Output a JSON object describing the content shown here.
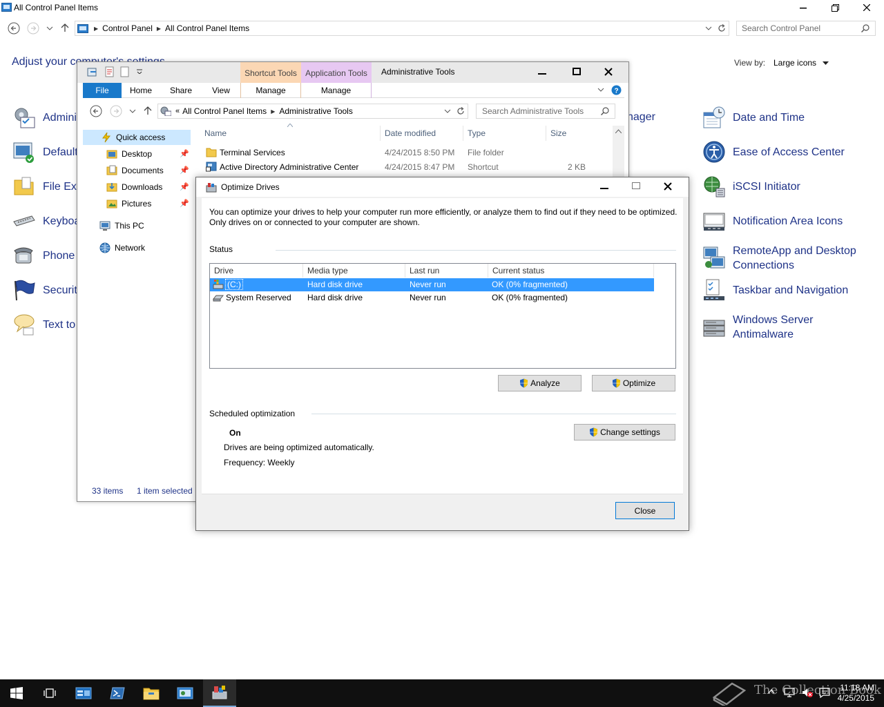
{
  "control_panel": {
    "title": "All Control Panel Items",
    "breadcrumb": [
      "Control Panel",
      "All Control Panel Items"
    ],
    "search_placeholder": "Search Control Panel",
    "heading": "Adjust your computer's settings",
    "view_by_label": "View by:",
    "view_by_value": "Large icons",
    "left_items": [
      {
        "label": "Administrative Tools",
        "icon": "admin-tools-icon"
      },
      {
        "label": "Default Programs",
        "icon": "default-programs-icon"
      },
      {
        "label": "File Explorer Options",
        "icon": "folder-options-icon"
      },
      {
        "label": "Keyboard",
        "icon": "keyboard-icon"
      },
      {
        "label": "Phone and Modem",
        "icon": "phone-icon"
      },
      {
        "label": "Security and Maintenance",
        "icon": "flag-icon"
      },
      {
        "label": "Text to Speech",
        "icon": "speech-icon"
      }
    ],
    "partial_item": "nager",
    "right_items": [
      {
        "label": "Date and Time",
        "icon": "clock-calendar-icon"
      },
      {
        "label": "Ease of Access Center",
        "icon": "ease-of-access-icon"
      },
      {
        "label": "iSCSI Initiator",
        "icon": "iscsi-icon"
      },
      {
        "label": "Notification Area Icons",
        "icon": "notification-icon"
      },
      {
        "label": "RemoteApp and Desktop Connections",
        "icon": "remoteapp-icon"
      },
      {
        "label": "Taskbar and Navigation",
        "icon": "taskbar-icon"
      },
      {
        "label": "Windows Server Antimalware",
        "icon": "antimalware-icon"
      }
    ]
  },
  "explorer": {
    "title": "Administrative Tools",
    "context_tabs": {
      "shortcut": "Shortcut Tools",
      "application": "Application Tools"
    },
    "ribbon_tabs": [
      "File",
      "Home",
      "Share",
      "View",
      "Manage",
      "Manage"
    ],
    "address": [
      "All Control Panel Items",
      "Administrative Tools"
    ],
    "search_placeholder": "Search Administrative Tools",
    "nav": {
      "quick_access": "Quick access",
      "pinned": [
        "Desktop",
        "Documents",
        "Downloads",
        "Pictures"
      ],
      "this_pc": "This PC",
      "network": "Network"
    },
    "columns": [
      "Name",
      "Date modified",
      "Type",
      "Size"
    ],
    "rows": [
      {
        "name": "Terminal Services",
        "date": "4/24/2015 8:50 PM",
        "type": "File folder",
        "size": ""
      },
      {
        "name": "Active Directory Administrative Center",
        "date": "4/24/2015 8:47 PM",
        "type": "Shortcut",
        "size": "2 KB"
      }
    ],
    "status": {
      "count": "33 items",
      "selected": "1 item selected"
    }
  },
  "optimize_drives": {
    "title": "Optimize Drives",
    "description": "You can optimize your drives to help your computer run more efficiently, or analyze them to find out if they need to be optimized. Only drives on or connected to your computer are shown.",
    "status_label": "Status",
    "columns": [
      "Drive",
      "Media type",
      "Last run",
      "Current status"
    ],
    "drives": [
      {
        "drive": "(C:)",
        "media": "Hard disk drive",
        "last_run": "Never run",
        "status": "OK (0% fragmented)",
        "selected": true
      },
      {
        "drive": "System Reserved",
        "media": "Hard disk drive",
        "last_run": "Never run",
        "status": "OK (0% fragmented)",
        "selected": false
      }
    ],
    "analyze_label": "Analyze",
    "optimize_label": "Optimize",
    "scheduled_label": "Scheduled optimization",
    "scheduled_state": "On",
    "scheduled_desc": "Drives are being optimized automatically.",
    "frequency": "Frequency: Weekly",
    "change_settings_label": "Change settings",
    "close_label": "Close"
  },
  "taskbar": {
    "time": "11:18 AM",
    "date": "4/25/2015",
    "watermark": "The Collection Book"
  },
  "colors": {
    "accent": "#1979ca",
    "link": "#1e3287",
    "selection": "#3399ff",
    "shortcut_tools_bg": "#fbd7b4",
    "application_tools_bg": "#e7c8f2"
  }
}
